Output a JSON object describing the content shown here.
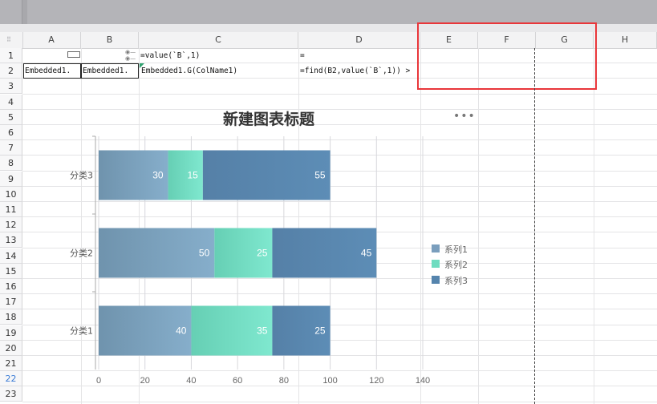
{
  "columns": [
    "A",
    "B",
    "C",
    "D",
    "E",
    "F",
    "G",
    "H"
  ],
  "rows": [
    "1",
    "2",
    "3",
    "4",
    "5",
    "6",
    "7",
    "8",
    "9",
    "10",
    "11",
    "12",
    "13",
    "14",
    "15",
    "16",
    "17",
    "18",
    "19",
    "20",
    "21",
    "22",
    "23"
  ],
  "selected_row": "22",
  "cells": {
    "C1": "=value(`B`,1)",
    "D1": "=",
    "A2": "Embedded1.",
    "B2": "Embedded1.",
    "C2": "Embedded1.G(ColName1)",
    "D2": "=find(B2,value(`B`,1)) >"
  },
  "chart": {
    "more_label": "•••",
    "legend": [
      {
        "name": "系列1",
        "color": "#7a9ebd"
      },
      {
        "name": "系列2",
        "color": "#6fdcc0"
      },
      {
        "name": "系列3",
        "color": "#5584ad"
      }
    ]
  },
  "chart_data": {
    "type": "bar",
    "orientation": "horizontal",
    "stacked": true,
    "title": "新建图表标题",
    "categories": [
      "分类3",
      "分类2",
      "分类1"
    ],
    "series": [
      {
        "name": "系列1",
        "values": [
          30,
          50,
          40
        ]
      },
      {
        "name": "系列2",
        "values": [
          15,
          25,
          35
        ]
      },
      {
        "name": "系列3",
        "values": [
          55,
          45,
          25
        ]
      }
    ],
    "xlim": [
      0,
      140
    ],
    "xticks": [
      "0",
      "20",
      "40",
      "60",
      "80",
      "100",
      "120",
      "140"
    ],
    "grid": true,
    "legend_position": "right"
  }
}
